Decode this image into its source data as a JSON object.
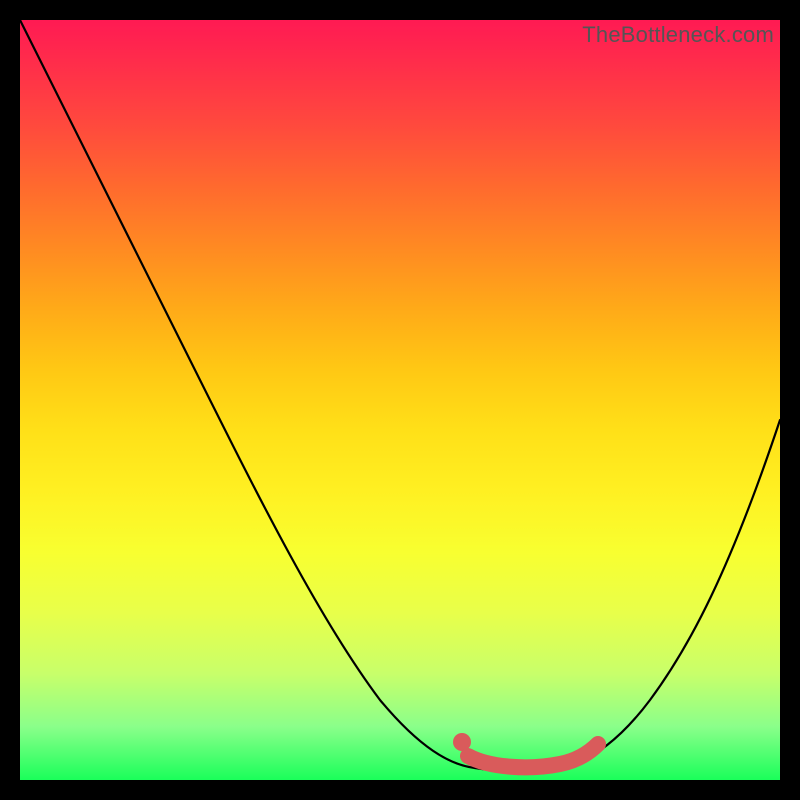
{
  "watermark": "TheBottleneck.com",
  "colors": {
    "accent": "#d95b5b",
    "curve": "#000000",
    "gradient_top": "#ff1a53",
    "gradient_bottom": "#1aff5a"
  },
  "chart_data": {
    "type": "line",
    "title": "",
    "xlabel": "",
    "ylabel": "",
    "xlim": [
      0,
      100
    ],
    "ylim": [
      0,
      100
    ],
    "grid": false,
    "legend": false,
    "series": [
      {
        "name": "bottleneck-curve",
        "x": [
          0,
          6,
          12,
          18,
          24,
          30,
          36,
          42,
          48,
          54,
          58,
          62,
          66,
          70,
          74,
          78,
          82,
          86,
          90,
          94,
          98,
          100
        ],
        "y": [
          100,
          90,
          80,
          70,
          60,
          50,
          41,
          32,
          23,
          14,
          8,
          4,
          1,
          0,
          1,
          4,
          9,
          16,
          24,
          33,
          43,
          48
        ]
      }
    ],
    "annotations": [
      {
        "name": "optimal-range",
        "x_start": 58,
        "x_end": 72,
        "y": 5
      }
    ]
  }
}
